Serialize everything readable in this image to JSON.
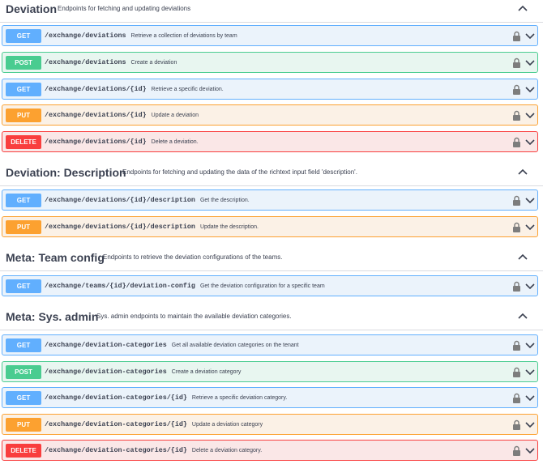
{
  "sections": [
    {
      "title": "Deviation",
      "description": "Endpoints for fetching and updating deviations",
      "operations": [
        {
          "method": "GET",
          "path": "/exchange/deviations",
          "summary": "Retrieve a collection of deviations by team"
        },
        {
          "method": "POST",
          "path": "/exchange/deviations",
          "summary": "Create a deviation"
        },
        {
          "method": "GET",
          "path": "/exchange/deviations/{id}",
          "summary": "Retrieve a specific deviation."
        },
        {
          "method": "PUT",
          "path": "/exchange/deviations/{id}",
          "summary": "Update a deviation"
        },
        {
          "method": "DELETE",
          "path": "/exchange/deviations/{id}",
          "summary": "Delete a deviation."
        }
      ]
    },
    {
      "title": "Deviation: Description",
      "description": "Endpoints for fetching and updating the data of the richtext input field 'description'.",
      "operations": [
        {
          "method": "GET",
          "path": "/exchange/deviations/{id}/description",
          "summary": "Get the description."
        },
        {
          "method": "PUT",
          "path": "/exchange/deviations/{id}/description",
          "summary": "Update the description."
        }
      ]
    },
    {
      "title": "Meta: Team config",
      "description": "Endpoints to retrieve the deviation configurations of the teams.",
      "operations": [
        {
          "method": "GET",
          "path": "/exchange/teams/{id}/deviation-config",
          "summary": "Get the deviation configuration for a specific team"
        }
      ]
    },
    {
      "title": "Meta: Sys. admin",
      "description": "Sys. admin endpoints to maintain the available deviation categories.",
      "operations": [
        {
          "method": "GET",
          "path": "/exchange/deviation-categories",
          "summary": "Get all available deviation categories on the tenant"
        },
        {
          "method": "POST",
          "path": "/exchange/deviation-categories",
          "summary": "Create a deviation category"
        },
        {
          "method": "GET",
          "path": "/exchange/deviation-categories/{id}",
          "summary": "Retrieve a specific deviation category."
        },
        {
          "method": "PUT",
          "path": "/exchange/deviation-categories/{id}",
          "summary": "Update a deviation category"
        },
        {
          "method": "DELETE",
          "path": "/exchange/deviation-categories/{id}",
          "summary": "Delete a deviation category."
        }
      ]
    }
  ],
  "icons": {
    "lock": "lock-icon",
    "expand": "chevron-down-icon",
    "collapse": "chevron-up-icon"
  },
  "colors": {
    "get": "#61affe",
    "post": "#49cc90",
    "put": "#fca130",
    "delete": "#f93e3e"
  }
}
